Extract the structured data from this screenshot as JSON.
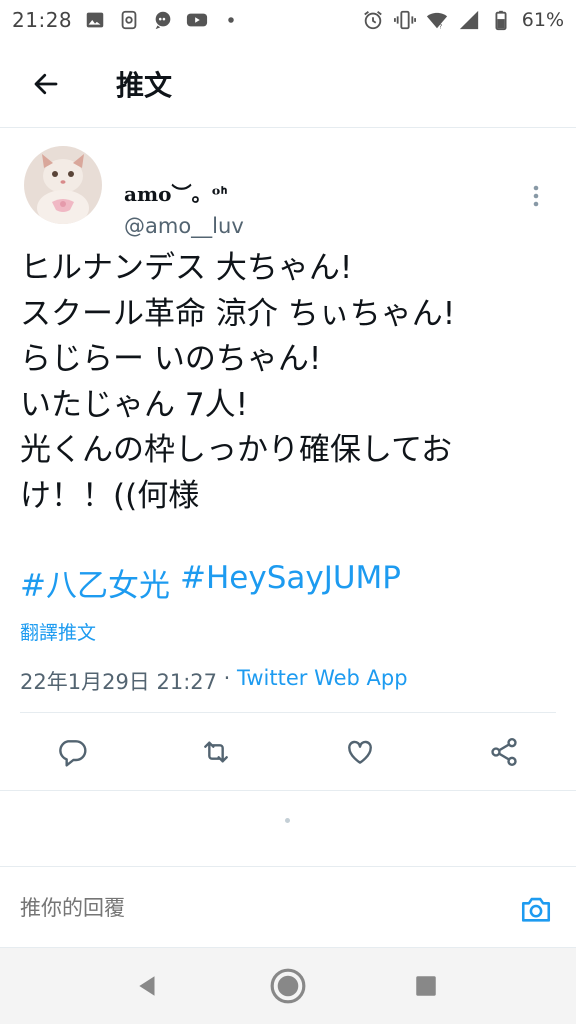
{
  "status_bar": {
    "time": "21:28",
    "battery_percent": "61%",
    "left_icons": [
      "image-icon",
      "sim-icon",
      "chat-bubble-icon",
      "youtube-icon",
      "dot-icon"
    ],
    "right_icons": [
      "alarm-icon",
      "vibrate-icon",
      "wifi-icon",
      "signal-icon",
      "battery-icon"
    ]
  },
  "header": {
    "title": "推文",
    "back_icon": "arrow-left-icon"
  },
  "tweet": {
    "display_name": "amo︶。ᵒᑋ",
    "handle": "@amo__luv",
    "text": "ヒルナンデス 大ちゃん!\nスクール革命 涼介 ちぃちゃん!\nらじらー いのちゃん!\nいたじゃん 7人!\n光くんの枠しっかり確保してお\nけ！！((何様",
    "hashtags": [
      "#八乙女光",
      "#HeySayJUMP"
    ],
    "translate_label": "翻譯推文",
    "timestamp": "22年1月29日 21:27",
    "separator": " · ",
    "source": "Twitter Web App"
  },
  "actions": [
    "reply-icon",
    "retweet-icon",
    "like-icon",
    "share-icon"
  ],
  "reply": {
    "placeholder": "推你的回覆"
  },
  "nav": [
    "back-triangle-icon",
    "home-circle-icon",
    "recents-square-icon"
  ],
  "colors": {
    "accent": "#1d9bf0",
    "text": "#0f1419",
    "secondary": "#536471",
    "divider": "#e6ecf0"
  }
}
